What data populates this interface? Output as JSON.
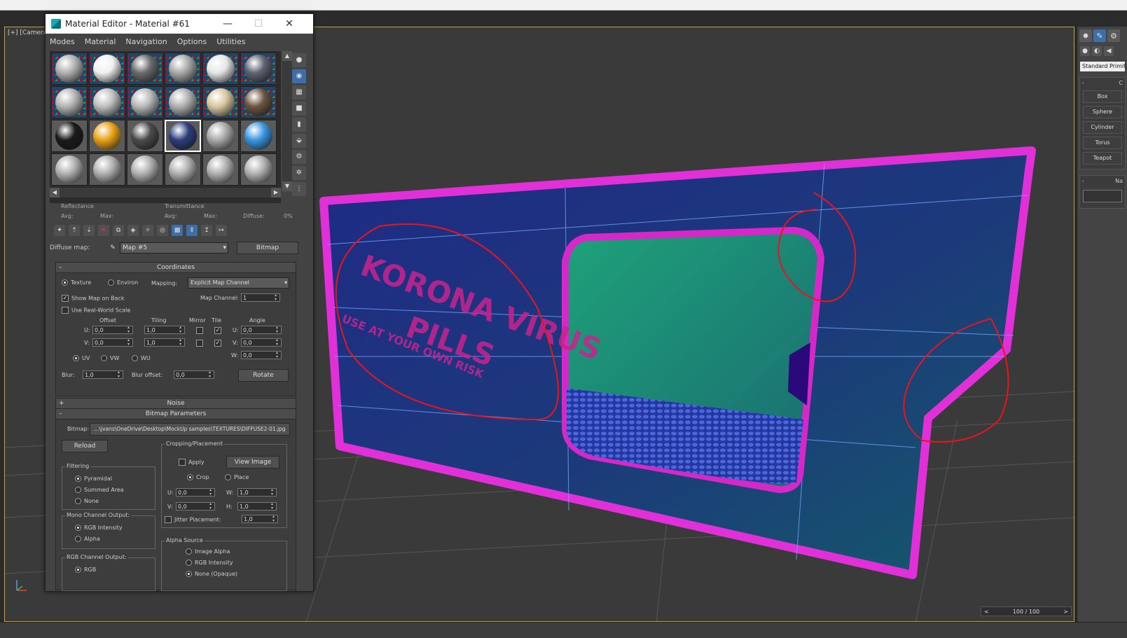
{
  "viewport": {
    "label": "[+] [Camera"
  },
  "timeslider": {
    "frame": "100 / 100",
    "prev": "<",
    "next": ">"
  },
  "right_panel": {
    "dropdown": "Standard Primitives",
    "group_head_a": "-",
    "group_head_b": "C",
    "buttons": [
      "Box",
      "Sphere",
      "Cylinder",
      "Torus",
      "Teapot"
    ],
    "name_head_a": "-",
    "name_head_b": "Na"
  },
  "editor": {
    "title": "Material Editor - Material #61",
    "menu": [
      "Modes",
      "Material",
      "Navigation",
      "Options",
      "Utilities"
    ],
    "slot_colors": [
      "#b0b0b0",
      "#f0f0f0",
      "#6a6a6a",
      "#a8a8a8",
      "#e6e6e6",
      "#5d6470",
      "#b4b4b4",
      "#c0c0c0",
      "#b8b8b8",
      "#b0b0b0",
      "#d9c7a0",
      "#6b5440",
      "#1a1a1a",
      "#e9a217",
      "#4a4a4a",
      "#2c3e7a",
      "#a8a8a8",
      "#3a96df",
      "#b0b0b0",
      "#b0b0b0",
      "#b0b0b0",
      "#b0b0b0",
      "#b0b0b0",
      "#b0b0b0"
    ],
    "info": {
      "reflectance": "Reflectance",
      "transmittance": "Transmittance",
      "avg": "Avg:",
      "max": "Max:",
      "diffuse": "Diffuse:",
      "diffuse_val": "0%"
    },
    "diffuse_map_label": "Diffuse map:",
    "map_name": "Map #5",
    "map_type": "Bitmap",
    "coordinates": {
      "title": "Coordinates",
      "texture": "Texture",
      "environ": "Environ",
      "mapping_label": "Mapping:",
      "mapping": "Explicit Map Channel",
      "show_map_on_back": "Show Map on Back",
      "map_channel_label": "Map Channel:",
      "map_channel": "1",
      "use_real_world": "Use Real-World Scale",
      "offset": "Offset",
      "tiling": "Tiling",
      "mirror": "Mirror",
      "tile": "Tile",
      "angle": "Angle",
      "u": "U:",
      "v": "V:",
      "w": "W:",
      "offset_u": "0,0",
      "offset_v": "0,0",
      "tiling_u": "1,0",
      "tiling_v": "1,0",
      "angle_u": "0,0",
      "angle_v": "0,0",
      "angle_w": "0,0",
      "uv": "UV",
      "vw": "VW",
      "wu": "WU",
      "blur_label": "Blur:",
      "blur": "1,0",
      "blur_offset_label": "Blur offset:",
      "blur_offset": "0,0",
      "rotate": "Rotate"
    },
    "noise": {
      "title": "Noise"
    },
    "bitmap_params": {
      "title": "Bitmap Parameters",
      "bitmap_label": "Bitmap:",
      "path": "...\\jvans\\OneDrive\\Desktop\\MockUp samples\\TEXTURES\\DIFFUSE2-01.jpg",
      "reload": "Reload",
      "cropping": "Cropping/Placement",
      "apply": "Apply",
      "view_image": "View Image",
      "crop": "Crop",
      "place": "Place",
      "u": "U:",
      "v": "V:",
      "w": "W:",
      "h": "H:",
      "u_val": "0,0",
      "v_val": "0,0",
      "w_val": "1,0",
      "h_val": "1,0",
      "jitter": "Jitter Placement:",
      "jitter_val": "1,0",
      "filtering": "Filtering",
      "pyramidal": "Pyramidal",
      "summed_area": "Summed Area",
      "none": "None",
      "mono_output": "Mono Channel Output:",
      "rgb_intensity": "RGB Intensity",
      "alpha": "Alpha",
      "rgb_output": "RGB Channel Output:",
      "rgb": "RGB",
      "alpha_source": "Alpha Source",
      "image_alpha": "Image Alpha",
      "alpha_rgb_intensity": "RGB Intensity",
      "none_opaque": "None (Opaque)"
    }
  },
  "scene": {
    "texture_line1": "KORONA VIRUS",
    "texture_line2": "PILLS",
    "texture_line3": "USE AT YOUR OWN RISK"
  }
}
